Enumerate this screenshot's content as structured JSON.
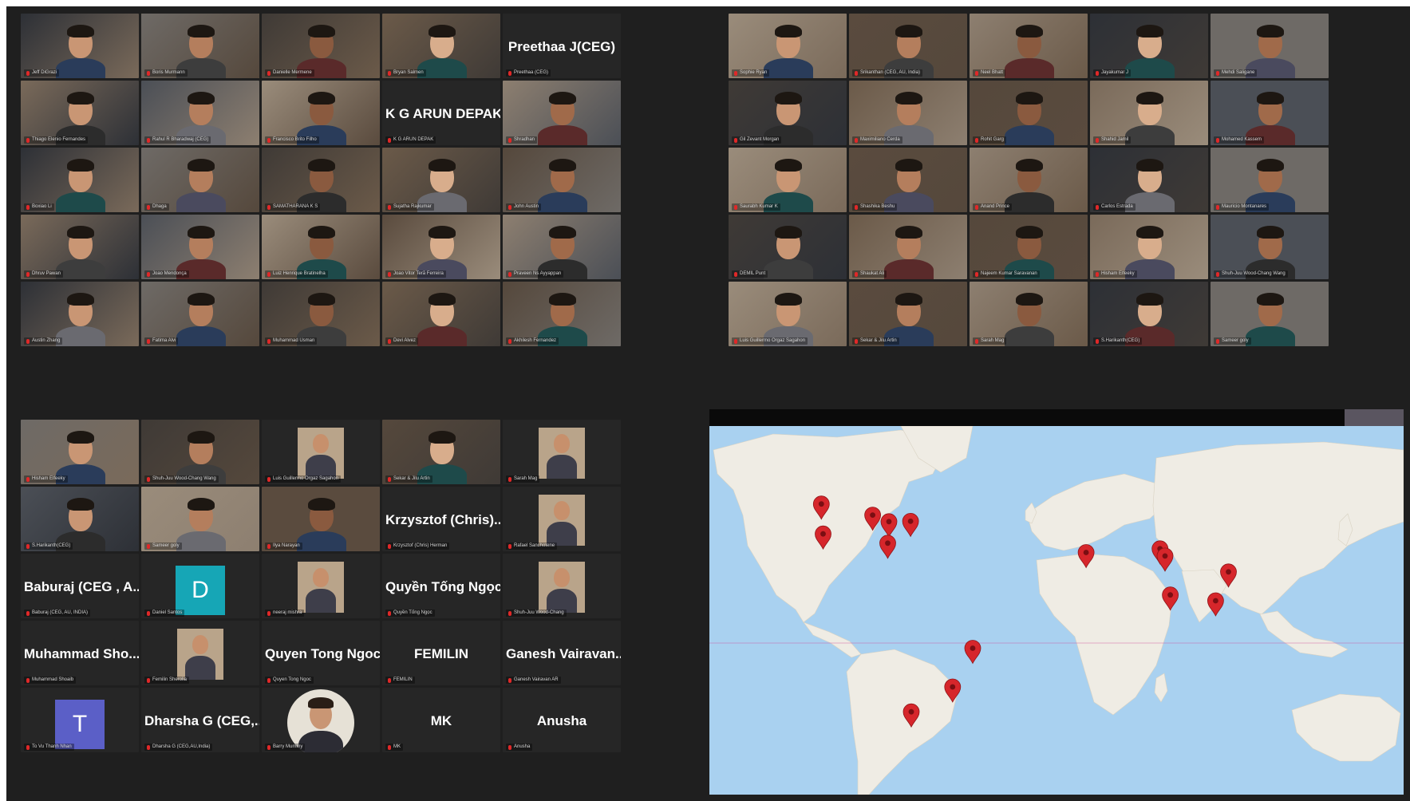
{
  "window": {
    "title": ""
  },
  "colors": {
    "background": "#1f1f1f",
    "tile": "#262626",
    "mic_muted": "#e02828",
    "active_speaker": "#d8c95a",
    "map_water": "#a9d1f0",
    "map_land": "#efece4",
    "pin": "#d6262b"
  },
  "gallery_top_left": [
    {
      "label": "Jeff DiGrazi",
      "big_name": "",
      "type": "video"
    },
    {
      "label": "Boris Murmann",
      "big_name": "",
      "type": "video",
      "active": true
    },
    {
      "label": "Danielle Mermene",
      "big_name": "",
      "type": "video"
    },
    {
      "label": "Bryan Salmen",
      "big_name": "",
      "type": "video"
    },
    {
      "label": "Preethaa (CEG)",
      "big_name": "Preethaa J(CEG)",
      "type": "name"
    },
    {
      "label": "Thiago Elenio Fernandes",
      "big_name": "",
      "type": "video"
    },
    {
      "label": "Rahul R Bharadwaj (CEG)",
      "big_name": "",
      "type": "video"
    },
    {
      "label": "Francisco Brito Filho",
      "big_name": "",
      "type": "video"
    },
    {
      "label": "K G ARUN DEPAK",
      "big_name": "K G ARUN DEPAK",
      "type": "name"
    },
    {
      "label": "Shradhan",
      "big_name": "",
      "type": "video"
    },
    {
      "label": "Boxiao Li",
      "big_name": "",
      "type": "video"
    },
    {
      "label": "Dhaga",
      "big_name": "",
      "type": "video"
    },
    {
      "label": "SAMATHARANA K S",
      "big_name": "",
      "type": "video"
    },
    {
      "label": "Sujatha Rajkumar",
      "big_name": "",
      "type": "video"
    },
    {
      "label": "John Austin",
      "big_name": "",
      "type": "video"
    },
    {
      "label": "Dhruv Pawan",
      "big_name": "",
      "type": "video"
    },
    {
      "label": "Joao Mendonça",
      "big_name": "",
      "type": "video"
    },
    {
      "label": "Luiz Henrique Bratinelha",
      "big_name": "",
      "type": "video"
    },
    {
      "label": "Joao Vitor Terã Ferreira",
      "big_name": "",
      "type": "video"
    },
    {
      "label": "Praveen Ns Ayyappan",
      "big_name": "",
      "type": "video"
    },
    {
      "label": "Austin Zhang",
      "big_name": "",
      "type": "video"
    },
    {
      "label": "Fatima Alvi",
      "big_name": "",
      "type": "video"
    },
    {
      "label": "Muhammad Usman",
      "big_name": "",
      "type": "video"
    },
    {
      "label": "Devi Alvez",
      "big_name": "",
      "type": "video"
    },
    {
      "label": "Akhilesh Fernandez",
      "big_name": "",
      "type": "video"
    }
  ],
  "gallery_top_right": [
    {
      "label": "Sophie Ryan",
      "big_name": "",
      "type": "video"
    },
    {
      "label": "Srikanthan (CEG, AU, India)",
      "big_name": "",
      "type": "video"
    },
    {
      "label": "Neel Bhatt",
      "big_name": "",
      "type": "video"
    },
    {
      "label": "Jayakumar J",
      "big_name": "",
      "type": "video"
    },
    {
      "label": "Mehdi Saligane",
      "big_name": "",
      "type": "video"
    },
    {
      "label": "Gil Zevant Morgan",
      "big_name": "",
      "type": "video"
    },
    {
      "label": "Maximiliano Cerda",
      "big_name": "",
      "type": "video"
    },
    {
      "label": "Rohit Garg",
      "big_name": "",
      "type": "video"
    },
    {
      "label": "Shahid Jamil",
      "big_name": "",
      "type": "video"
    },
    {
      "label": "Mohamed Kassem",
      "big_name": "",
      "type": "video"
    },
    {
      "label": "Saurabh Kumar K",
      "big_name": "",
      "type": "video"
    },
    {
      "label": "Shashika Beshu",
      "big_name": "",
      "type": "video"
    },
    {
      "label": "Anand Prince",
      "big_name": "",
      "type": "video"
    },
    {
      "label": "Carlos Estrada",
      "big_name": "",
      "type": "video"
    },
    {
      "label": "Mauricio Montanares",
      "big_name": "",
      "type": "video"
    },
    {
      "label": "DEMIL Punt",
      "big_name": "",
      "type": "video"
    },
    {
      "label": "Shaukat Ali",
      "big_name": "",
      "type": "video"
    },
    {
      "label": "Najeem Kumar Saravanan",
      "big_name": "",
      "type": "video"
    },
    {
      "label": "Hisham Elfeeky",
      "big_name": "",
      "type": "video"
    },
    {
      "label": "Shuh-Juu Wood-Chang Wang",
      "big_name": "",
      "type": "video"
    },
    {
      "label": "Luis Guillermo Orgaz Sagahon",
      "big_name": "",
      "type": "video"
    },
    {
      "label": "Sekar & Jilu Artin",
      "big_name": "",
      "type": "video"
    },
    {
      "label": "Sarah Mag",
      "big_name": "",
      "type": "video"
    },
    {
      "label": "S.Harikanth(CEG)",
      "big_name": "",
      "type": "video"
    },
    {
      "label": "Sameer goly",
      "big_name": "",
      "type": "video"
    }
  ],
  "gallery_bottom_left": [
    {
      "label": "Hisham Elfeeky",
      "big_name": "",
      "type": "video"
    },
    {
      "label": "Shuh-Juu Wood-Chang Wang",
      "big_name": "",
      "type": "video"
    },
    {
      "label": "Luis Guillermo Orgaz Sagahon",
      "big_name": "",
      "type": "thumb"
    },
    {
      "label": "Sekar & Jilu Artin",
      "big_name": "",
      "type": "video"
    },
    {
      "label": "Sarah Mag",
      "big_name": "",
      "type": "thumb"
    },
    {
      "label": "S.Harikanth(CEG)",
      "big_name": "",
      "type": "video"
    },
    {
      "label": "Sameer goly",
      "big_name": "",
      "type": "video"
    },
    {
      "label": "Ilya Narayan",
      "big_name": "",
      "type": "video"
    },
    {
      "label": "Krzysztof (Chris) Herman",
      "big_name": "Krzysztof (Chris)...",
      "type": "name"
    },
    {
      "label": "Rafael Sanchotene",
      "big_name": "",
      "type": "thumb"
    },
    {
      "label": "Baburaj (CEG, AU, INDIA)",
      "big_name": "Baburaj (CEG , A...",
      "type": "name"
    },
    {
      "label": "Daniel Santos",
      "big_name": "",
      "type": "avatar",
      "letter": "D",
      "avatar_color": "#16a6b6"
    },
    {
      "label": "neeraj mishra",
      "big_name": "",
      "type": "thumb"
    },
    {
      "label": "Quyền Tống Ngọc",
      "big_name": "Quyền Tống Ngọc",
      "type": "name"
    },
    {
      "label": "Shuh-Juu Wood-Chang",
      "big_name": "",
      "type": "thumb"
    },
    {
      "label": "Muhammad Shoaib",
      "big_name": "Muhammad Sho...",
      "type": "name"
    },
    {
      "label": "Femilin Sherolia",
      "big_name": "",
      "type": "thumb"
    },
    {
      "label": "Quyen Tong Ngoc",
      "big_name": "Quyen Tong Ngoc",
      "type": "name"
    },
    {
      "label": "FEMILIN",
      "big_name": "FEMILIN",
      "type": "name"
    },
    {
      "label": "Ganesh Vairavan AR",
      "big_name": "Ganesh Vairavan...",
      "type": "name"
    },
    {
      "label": "To Vu Thanh Nhan",
      "big_name": "",
      "type": "avatar",
      "letter": "T",
      "avatar_color": "#5b5fc7"
    },
    {
      "label": "Dharsha G (CEG,AU,India)",
      "big_name": "Dharsha G (CEG,...",
      "type": "name"
    },
    {
      "label": "Barry Mummy",
      "big_name": "",
      "type": "circle"
    },
    {
      "label": "MK",
      "big_name": "MK",
      "type": "name"
    },
    {
      "label": "Anusha",
      "big_name": "Anusha",
      "type": "name"
    }
  ],
  "map": {
    "pins": [
      {
        "place": "Vancouver",
        "lat": 49.3,
        "lon": -123.1
      },
      {
        "place": "Bay Area",
        "lat": 37.4,
        "lon": -122.1
      },
      {
        "place": "Minneapolis",
        "lat": 44.9,
        "lon": -93.2
      },
      {
        "place": "Ann Arbor",
        "lat": 42.3,
        "lon": -83.7
      },
      {
        "place": "Boston",
        "lat": 42.4,
        "lon": -71.1
      },
      {
        "place": "Atlanta",
        "lat": 33.7,
        "lon": -84.4
      },
      {
        "place": "Cairo",
        "lat": 30.0,
        "lon": 31.2
      },
      {
        "place": "Lahore",
        "lat": 31.5,
        "lon": 74.3
      },
      {
        "place": "Delhi",
        "lat": 28.6,
        "lon": 77.2
      },
      {
        "place": "Chennai",
        "lat": 13.1,
        "lon": 80.3
      },
      {
        "place": "Ho Chi Minh City",
        "lat": 10.8,
        "lon": 106.7
      },
      {
        "place": "Hong Kong",
        "lat": 22.3,
        "lon": 114.2
      },
      {
        "place": "Recife",
        "lat": -8.1,
        "lon": -34.9
      },
      {
        "place": "Sao Paulo",
        "lat": -23.5,
        "lon": -46.6
      },
      {
        "place": "Santiago",
        "lat": -33.4,
        "lon": -70.7
      }
    ]
  }
}
